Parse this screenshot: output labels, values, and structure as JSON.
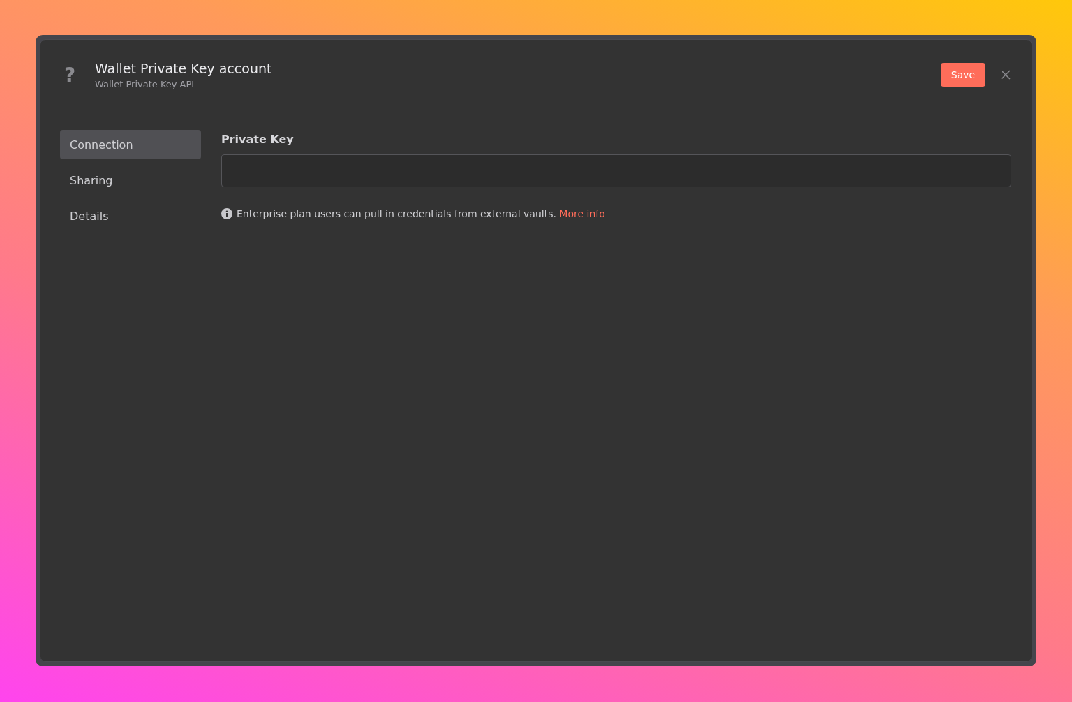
{
  "header": {
    "icon": "?",
    "title": "Wallet Private Key account",
    "subtitle": "Wallet Private Key API",
    "save_button": "Save"
  },
  "sidebar": {
    "items": [
      {
        "label": "Connection",
        "selected": true
      },
      {
        "label": "Sharing",
        "selected": false
      },
      {
        "label": "Details",
        "selected": false
      }
    ]
  },
  "form": {
    "field_label": "Private Key",
    "notice": "Enterprise plan users can pull in credentials from external vaults.",
    "notice_link": "More info"
  }
}
